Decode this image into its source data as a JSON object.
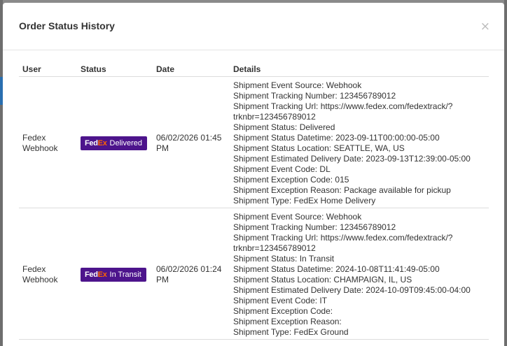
{
  "modal": {
    "title": "Order Status History",
    "close_label": "×"
  },
  "table": {
    "headers": {
      "user": "User",
      "status": "Status",
      "date": "Date",
      "details": "Details"
    },
    "rows": [
      {
        "user_line1": "Fedex",
        "user_line2": "Webhook",
        "badge": {
          "logo_fe": "Fed",
          "logo_ex": "Ex",
          "label": "Delivered",
          "bg": "#4d148c",
          "ex_color": "#ff6600"
        },
        "date_line1": "06/02/2026 01:45",
        "date_line2": "PM",
        "details": [
          "Shipment Event Source: Webhook",
          "Shipment Tracking Number: 123456789012",
          "Shipment Tracking Url: https://www.fedex.com/fedextrack/?",
          "trknbr=123456789012",
          "Shipment Status: Delivered",
          "Shipment Status Datetime: 2023-09-11T00:00:00-05:00",
          "Shipment Status Location: SEATTLE, WA, US",
          "Shipment Estimated Delivery Date: 2023-09-13T12:39:00-05:00",
          "Shipment Event Code: DL",
          "Shipment Exception Code: 015",
          "Shipment Exception Reason: Package available for pickup",
          "Shipment Type: FedEx Home Delivery"
        ]
      },
      {
        "user_line1": "Fedex",
        "user_line2": "Webhook",
        "badge": {
          "logo_fe": "Fed",
          "logo_ex": "Ex",
          "label": "In Transit",
          "bg": "#4d148c",
          "ex_color": "#ff6600"
        },
        "date_line1": "06/02/2026 01:24",
        "date_line2": "PM",
        "details": [
          "Shipment Event Source: Webhook",
          "Shipment Tracking Number: 123456789012",
          "Shipment Tracking Url: https://www.fedex.com/fedextrack/?",
          "trknbr=123456789012",
          "Shipment Status: In Transit",
          "Shipment Status Datetime: 2024-10-08T11:41:49-05:00",
          "Shipment Status Location: CHAMPAIGN, IL, US",
          "Shipment Estimated Delivery Date: 2024-10-09T09:45:00-04:00",
          "Shipment Event Code: IT",
          "Shipment Exception Code:",
          "Shipment Exception Reason:",
          "Shipment Type: FedEx Ground"
        ]
      }
    ]
  }
}
